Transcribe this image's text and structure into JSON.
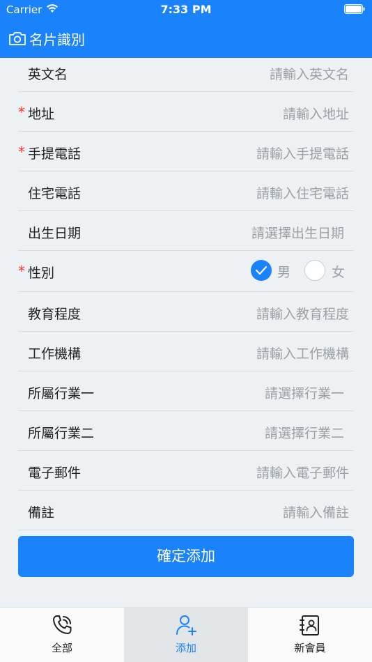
{
  "status_bar": {
    "carrier": "Carrier",
    "time": "7:33 PM"
  },
  "nav": {
    "title": "名片識別",
    "icon": "camera-icon"
  },
  "form": {
    "rows": [
      {
        "label": "英文名",
        "placeholder": "請輸入英文名",
        "required": false
      },
      {
        "label": "地址",
        "placeholder": "請輸入地址",
        "required": true
      },
      {
        "label": "手提電話",
        "placeholder": "請輸入手提電話",
        "required": true
      },
      {
        "label": "住宅電話",
        "placeholder": "請輸入住宅電話",
        "required": false
      },
      {
        "label": "出生日期",
        "placeholder": "請選擇出生日期",
        "required": false
      },
      {
        "label": "性別",
        "required": true
      },
      {
        "label": "教育程度",
        "placeholder": "請輸入教育程度",
        "required": false
      },
      {
        "label": "工作機構",
        "placeholder": "請輸入工作機構",
        "required": false
      },
      {
        "label": "所屬行業一",
        "placeholder": "請選擇行業一",
        "required": false
      },
      {
        "label": "所屬行業二",
        "placeholder": "請選擇行業二",
        "required": false
      },
      {
        "label": "電子郵件",
        "placeholder": "請輸入電子郵件",
        "required": false
      },
      {
        "label": "備註",
        "placeholder": "請輸入備註",
        "required": false
      }
    ],
    "required_mark": "*",
    "gender": {
      "male": "男",
      "female": "女",
      "selected": "男"
    }
  },
  "confirm_button": "確定添加",
  "tabs": [
    {
      "label": "全部",
      "icon": "phone-icon",
      "active": false
    },
    {
      "label": "添加",
      "icon": "add-user-icon",
      "active": true
    },
    {
      "label": "新會員",
      "icon": "contact-card-icon",
      "active": false
    }
  ],
  "colors": {
    "accent": "#1a82fb",
    "required": "#ff2d2d",
    "placeholder": "#9aa0a6"
  }
}
